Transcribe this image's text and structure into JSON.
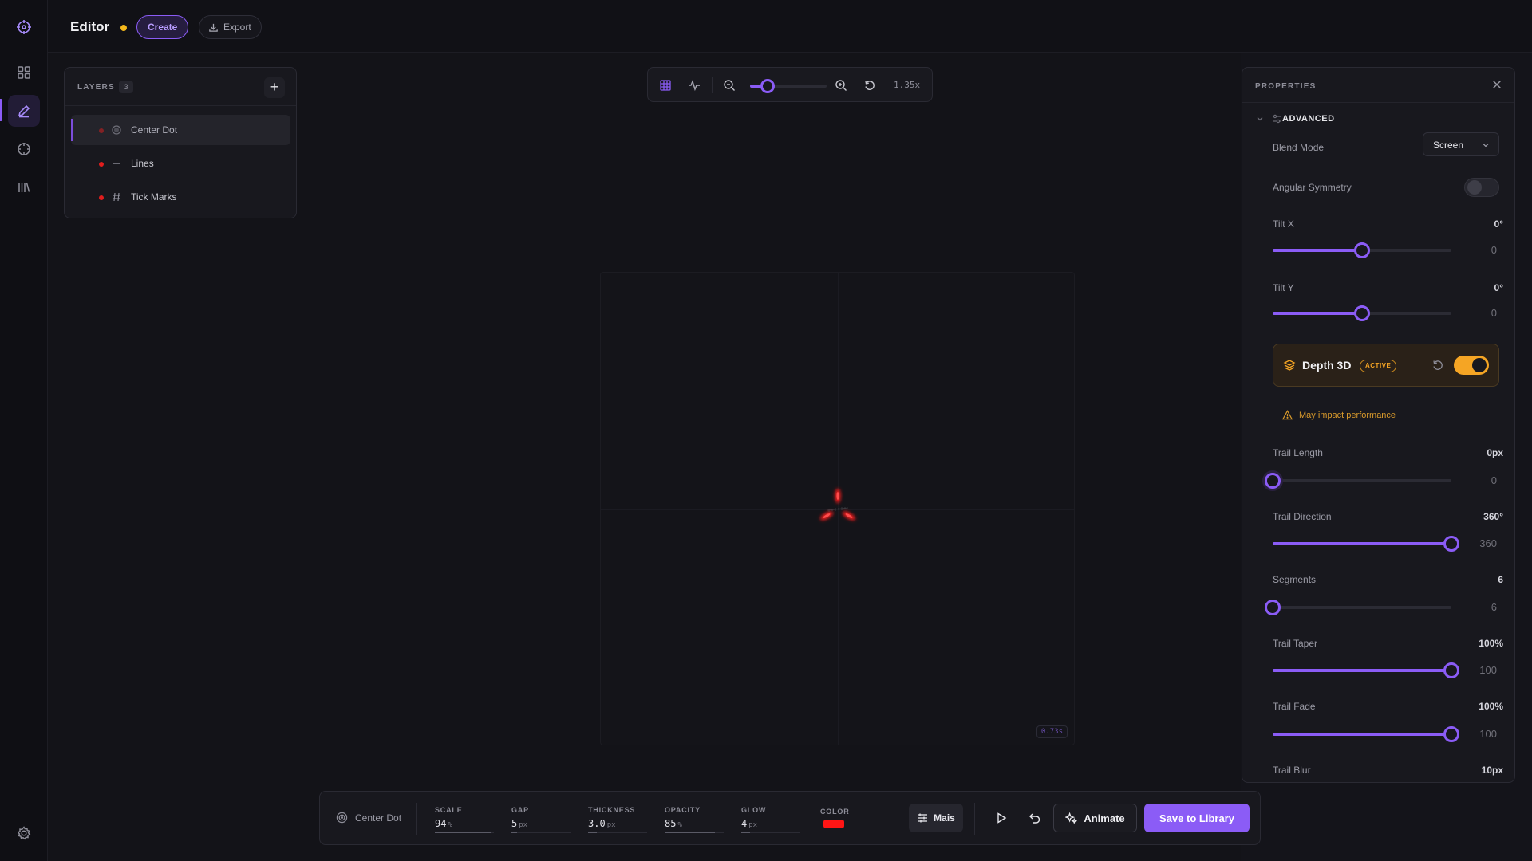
{
  "topbar": {
    "title": "Editor",
    "create_label": "Create",
    "export_label": "Export"
  },
  "rail": {
    "icons": [
      "logo-icon",
      "grid-icon",
      "pen-icon",
      "crosshair-icon",
      "library-icon",
      "settings-icon"
    ],
    "active": "pen-icon"
  },
  "layers": {
    "title": "LAYERS",
    "count": "3",
    "items": [
      {
        "name": "Center Dot",
        "icon": "circle-icon",
        "selected": true
      },
      {
        "name": "Lines",
        "icon": "dash-icon",
        "selected": false
      },
      {
        "name": "Tick Marks",
        "icon": "hash-icon",
        "selected": false
      }
    ]
  },
  "zoom": {
    "level_text": "1.35x",
    "slider_value": 0.23
  },
  "canvas": {
    "timer": "0.73s"
  },
  "properties": {
    "title": "PROPERTIES",
    "section": "ADVANCED",
    "blend_mode_label": "Blend Mode",
    "blend_mode_value": "Screen",
    "angular_symmetry_label": "Angular Symmetry",
    "angular_symmetry_on": false,
    "tilt_x": {
      "label": "Tilt X",
      "display": "0°",
      "number": "0",
      "fraction": 0.5
    },
    "tilt_y": {
      "label": "Tilt Y",
      "display": "0°",
      "number": "0",
      "fraction": 0.5
    },
    "depth": {
      "title": "Depth 3D",
      "badge": "ACTIVE",
      "on": true
    },
    "warning": "May impact performance",
    "trail_length": {
      "label": "Trail Length",
      "display": "0px",
      "number": "0",
      "fraction": 0.0
    },
    "trail_direction": {
      "label": "Trail Direction",
      "display": "360°",
      "number": "360",
      "fraction": 1.0
    },
    "segments": {
      "label": "Segments",
      "display": "6",
      "number": "6",
      "fraction": 0.0
    },
    "trail_taper": {
      "label": "Trail Taper",
      "display": "100%",
      "number": "100",
      "fraction": 1.0
    },
    "trail_fade": {
      "label": "Trail Fade",
      "display": "100%",
      "number": "100",
      "fraction": 1.0
    },
    "trail_blur": {
      "label": "Trail Blur",
      "display": "10px"
    }
  },
  "bottom": {
    "layer_name": "Center Dot",
    "stats": [
      {
        "label": "SCALE",
        "value": "94",
        "unit": "%",
        "fraction": 0.94
      },
      {
        "label": "GAP",
        "value": "5",
        "unit": "px",
        "fraction": 0.1
      },
      {
        "label": "THICKNESS",
        "value": "3.0",
        "unit": "px",
        "fraction": 0.15
      },
      {
        "label": "OPACITY",
        "value": "85",
        "unit": "%",
        "fraction": 0.85
      },
      {
        "label": "GLOW",
        "value": "4",
        "unit": "px",
        "fraction": 0.15
      }
    ],
    "color_label": "COLOR",
    "color_value": "#ff1515",
    "mais_label": "Mais",
    "animate_label": "Animate",
    "save_label": "Save to Library"
  },
  "colors": {
    "accent": "#8b5cf6",
    "warning": "#f5a524",
    "layer_dot": "#e11d1d"
  }
}
